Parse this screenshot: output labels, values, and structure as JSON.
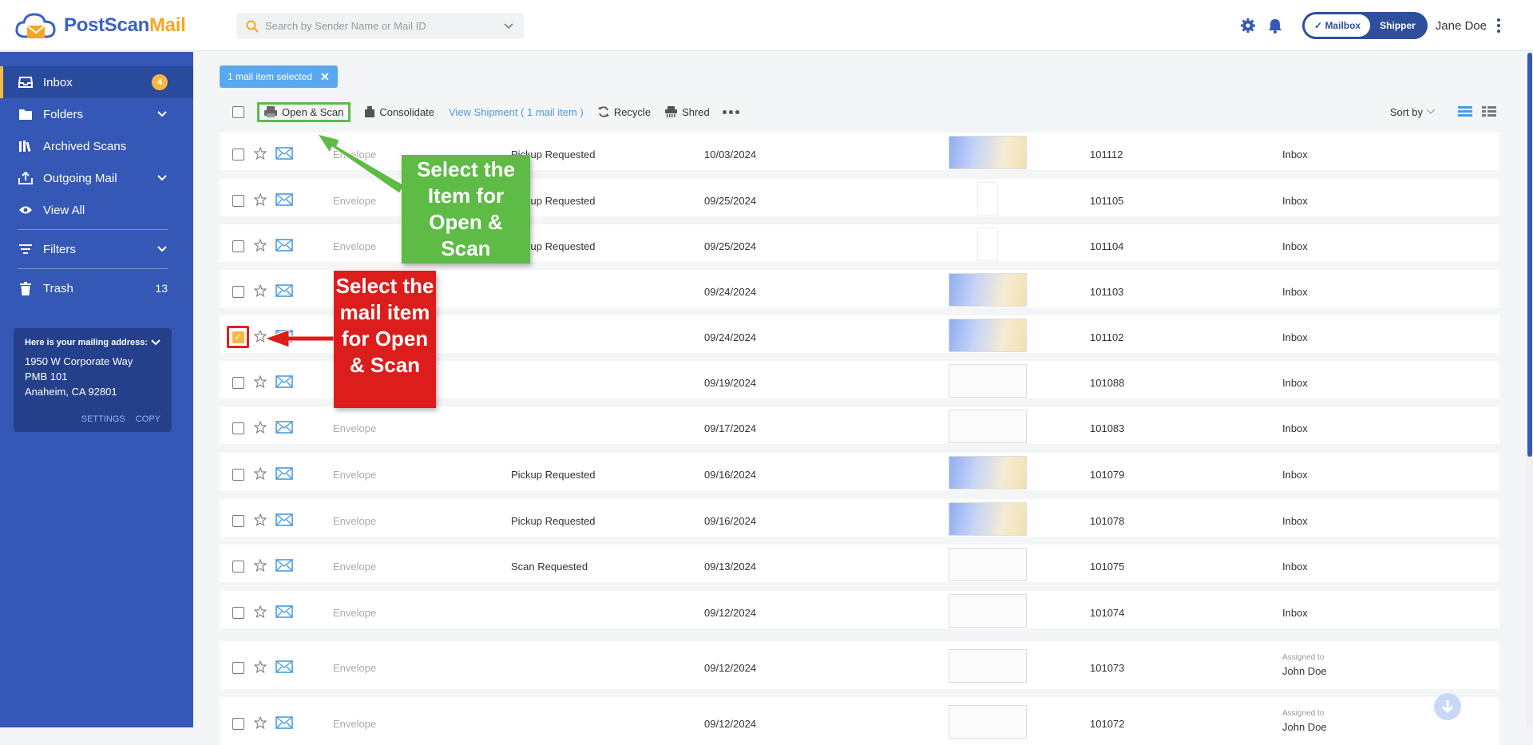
{
  "brand": {
    "name_part1": "PostScan",
    "name_part2": "Mail"
  },
  "search": {
    "placeholder": "Search by Sender Name or Mail ID"
  },
  "header": {
    "mode_options": [
      "Mailbox",
      "Shipper"
    ],
    "active_mode": "Mailbox",
    "user_name": "Jane Doe"
  },
  "sidebar": {
    "items": [
      {
        "label": "Inbox",
        "badge": "4",
        "icon": "inbox-icon"
      },
      {
        "label": "Folders",
        "icon": "folder-icon",
        "expandable": true
      },
      {
        "label": "Archived Scans",
        "icon": "archive-icon"
      },
      {
        "label": "Outgoing Mail",
        "icon": "outbox-icon",
        "expandable": true
      },
      {
        "label": "View All",
        "icon": "eye-icon"
      },
      {
        "label": "Filters",
        "icon": "filter-icon",
        "expandable": true
      },
      {
        "label": "Trash",
        "count": "13",
        "icon": "trash-icon"
      }
    ],
    "address": {
      "heading": "Here is your mailing address:",
      "line1": "1950 W Corporate Way",
      "line2": "PMB 101",
      "line3": "Anaheim, CA 92801",
      "settings": "SETTINGS",
      "copy": "COPY"
    }
  },
  "selection": {
    "chip_label": "1 mail item selected"
  },
  "toolbar": {
    "open_scan": "Open & Scan",
    "consolidate": "Consolidate",
    "view_shipment": "View Shipment ( 1 mail item )",
    "recycle": "Recycle",
    "shred": "Shred",
    "sort_by": "Sort by"
  },
  "rows": [
    {
      "type": "Envelope",
      "status": "Pickup Requested",
      "date": "10/03/2024",
      "id": "101112",
      "location": "Inbox",
      "thumb": "blue"
    },
    {
      "type": "Envelope",
      "status": "Pickup Requested",
      "date": "09/25/2024",
      "id": "101105",
      "location": "Inbox",
      "thumb": "pen"
    },
    {
      "type": "Envelope",
      "status": "Pickup Requested",
      "date": "09/25/2024",
      "id": "101104",
      "location": "Inbox",
      "thumb": "pen"
    },
    {
      "type": "",
      "status": "",
      "date": "09/24/2024",
      "id": "101103",
      "location": "Inbox",
      "thumb": "blue"
    },
    {
      "type": "",
      "status": "",
      "date": "09/24/2024",
      "id": "101102",
      "location": "Inbox",
      "thumb": "blue",
      "checked": true
    },
    {
      "type": "",
      "status": "",
      "date": "09/19/2024",
      "id": "101088",
      "location": "Inbox",
      "thumb": "white"
    },
    {
      "type": "Envelope",
      "status": "",
      "date": "09/17/2024",
      "id": "101083",
      "location": "Inbox",
      "thumb": "white"
    },
    {
      "type": "Envelope",
      "status": "Pickup Requested",
      "date": "09/16/2024",
      "id": "101079",
      "location": "Inbox",
      "thumb": "blue"
    },
    {
      "type": "Envelope",
      "status": "Pickup Requested",
      "date": "09/16/2024",
      "id": "101078",
      "location": "Inbox",
      "thumb": "blue"
    },
    {
      "type": "Envelope",
      "status": "Scan Requested",
      "date": "09/13/2024",
      "id": "101075",
      "location": "Inbox",
      "thumb": "white"
    },
    {
      "type": "Envelope",
      "status": "",
      "date": "09/12/2024",
      "id": "101074",
      "location": "Inbox",
      "thumb": "white"
    },
    {
      "type": "Envelope",
      "status": "",
      "date": "09/12/2024",
      "id": "101073",
      "assigned_label": "Assigned to",
      "assigned_name": "John Doe",
      "thumb": "white"
    },
    {
      "type": "Envelope",
      "status": "",
      "date": "09/12/2024",
      "id": "101072",
      "assigned_label": "Assigned to",
      "assigned_name": "John Doe",
      "thumb": "white"
    }
  ],
  "callouts": {
    "green": "Select the Item for Open & Scan",
    "red": "Select the mail item for Open & Scan"
  },
  "colors": {
    "sidebar": "#3558b6",
    "accent": "#f5b842",
    "green": "#5dbb46",
    "red": "#dd1c1c",
    "link": "#4a9be0"
  }
}
